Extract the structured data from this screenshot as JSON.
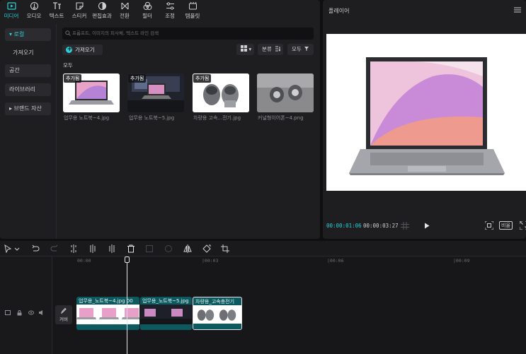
{
  "top_tabs": [
    {
      "label": "미디어",
      "icon": "media-icon"
    },
    {
      "label": "오디오",
      "icon": "audio-icon"
    },
    {
      "label": "텍스트",
      "icon": "text-icon"
    },
    {
      "label": "스티커",
      "icon": "sticker-icon"
    },
    {
      "label": "편집효과",
      "icon": "effects-icon"
    },
    {
      "label": "전환",
      "icon": "transition-icon"
    },
    {
      "label": "필터",
      "icon": "filter-icon"
    },
    {
      "label": "조정",
      "icon": "adjust-icon"
    },
    {
      "label": "템플릿",
      "icon": "template-icon"
    }
  ],
  "sidebar": {
    "items": [
      {
        "label": "▾ 로컬"
      },
      {
        "label": "가져오기"
      },
      {
        "label": "공간"
      },
      {
        "label": "라이브러리"
      },
      {
        "label": "▸ 브랜드 자산"
      }
    ]
  },
  "search": {
    "placeholder": "프롬프트, 이미지의 피사체, 텍스트 라인 검색"
  },
  "import_button": "가져오기",
  "view_toggle": "▾",
  "sort_label": "분류",
  "filter_label": "모두",
  "section_label": "모두",
  "media_items": [
    {
      "badge": "추가됨",
      "caption": "업무용 노트북~4.jpg"
    },
    {
      "badge": "추가됨",
      "caption": "업무용 노트북~5.jpg"
    },
    {
      "badge": "추가됨",
      "caption": "차량용 고속...전기.jpg"
    },
    {
      "badge": "",
      "caption": "커널형이어폰~4.png"
    }
  ],
  "player": {
    "title": "플레이어",
    "current_time": "00:00:01:06",
    "total_time": "00:00:03:27",
    "ratio_label": "비율"
  },
  "timeline": {
    "ticks": [
      "00:00",
      "|00:03",
      "|00:06",
      "|00:09"
    ],
    "cover_label": "커버",
    "clips": [
      {
        "label": "업무용_노트북~4.jpg  00"
      },
      {
        "label": "업무용_노트북~5.jpg"
      },
      {
        "label": "차량용_고속충전기"
      }
    ]
  },
  "colors": {
    "accent": "#2bd0d8",
    "clip": "#0c5a5f",
    "panel": "#1e1e21"
  }
}
